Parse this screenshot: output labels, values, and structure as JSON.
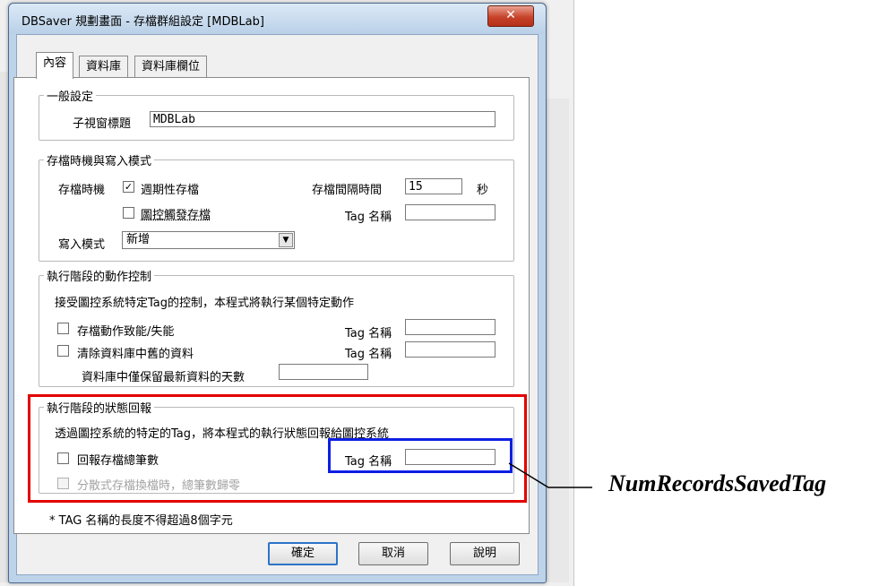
{
  "window": {
    "title": "DBSaver 規劃畫面 - 存檔群組設定 [MDBLab]",
    "close_glyph": "✕"
  },
  "tabs": [
    "內容",
    "資料庫",
    "資料庫欄位"
  ],
  "general": {
    "legend": "一般設定",
    "subtitle_label": "子視窗標題",
    "subtitle_value": "MDBLab"
  },
  "timing": {
    "legend": "存檔時機與寫入模式",
    "timing_label": "存檔時機",
    "periodic_label": "週期性存檔",
    "periodic_checked": true,
    "interval_label": "存檔間隔時間",
    "interval_value": "15",
    "interval_unit": "秒",
    "event_label": "圖控觸發存檔",
    "event_checked": false,
    "tag_label": "Tag 名稱",
    "tag_value": "",
    "write_mode_label": "寫入模式",
    "write_mode_value": "新增"
  },
  "action": {
    "legend": "執行階段的動作控制",
    "desc": "接受圖控系統特定Tag的控制，本程式將執行某個特定動作",
    "enable_label": "存檔動作致能/失能",
    "enable_checked": false,
    "clear_label": "清除資料庫中舊的資料",
    "clear_checked": false,
    "tag_label": "Tag 名稱",
    "days_label": "資料庫中僅保留最新資料的天數",
    "days_value": ""
  },
  "status": {
    "legend": "執行階段的狀態回報",
    "desc": "透過圖控系統的特定的Tag，將本程式的執行狀態回報給圖控系統",
    "report_label": "回報存檔總筆數",
    "report_checked": false,
    "tag_label": "Tag 名稱",
    "tag_value": "",
    "reset_label": "分散式存檔換檔時，總筆數歸零",
    "reset_checked": false
  },
  "note": "* TAG 名稱的長度不得超過8個字元",
  "buttons": {
    "ok": "確定",
    "cancel": "取消",
    "help": "說明"
  },
  "annotation": "NumRecordsSavedTag",
  "colors": {
    "highlight_red": "#e30000",
    "highlight_blue": "#0d1fe3"
  }
}
